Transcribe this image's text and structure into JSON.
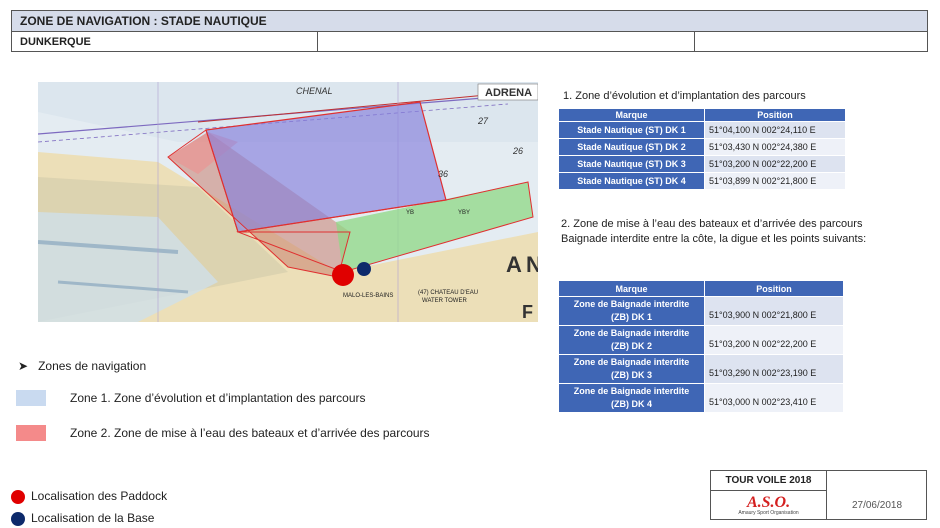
{
  "header": {
    "title": "ZONE DE NAVIGATION : STADE NAUTIQUE",
    "location": "DUNKERQUE"
  },
  "map": {
    "brand": "ADRENA",
    "labels": {
      "chenal": "CHENAL",
      "town": "MALO-LES-BAINS",
      "water_tower": "(47) CHATEAU D'EAU",
      "water_tower_en": "WATER TOWER",
      "yb": "YB",
      "yby": "YBY",
      "n26": "26",
      "n27": "27",
      "n36": "36",
      "bigA": "A",
      "bigN": "N",
      "bigF": "F"
    }
  },
  "section1": {
    "title": "1. Zone d’évolution et d’implantation des parcours",
    "headers": [
      "Marque",
      "Position"
    ],
    "rows": [
      {
        "mark": "Stade Nautique (ST) DK 1",
        "pos": "51°04,100 N  002°24,110 E"
      },
      {
        "mark": "Stade Nautique (ST) DK 2",
        "pos": "51°03,430 N  002°24,380 E"
      },
      {
        "mark": "Stade Nautique (ST) DK 3",
        "pos": "51°03,200 N  002°22,200 E"
      },
      {
        "mark": "Stade Nautique (ST) DK 4",
        "pos": "51°03,899 N  002°21,800 E"
      }
    ]
  },
  "section2": {
    "title": "2. Zone de mise à l’eau des bateaux et d’arrivée des parcours",
    "subtitle": "Baignade interdite entre la côte, la digue et les points suivants:",
    "headers": [
      "Marque",
      "Position"
    ],
    "rows": [
      {
        "mark1": "Zone de Baignade interdite",
        "mark2": "(ZB) DK 1",
        "pos": "51°03,900 N  002°21,800 E"
      },
      {
        "mark1": "Zone de Baignade interdite",
        "mark2": "(ZB) DK 2",
        "pos": "51°03,200 N  002°22,200 E"
      },
      {
        "mark1": "Zone de Baignade interdite",
        "mark2": "(ZB) DK 3",
        "pos": "51°03,290 N  002°23,190 E"
      },
      {
        "mark1": "Zone de Baignade interdite",
        "mark2": "(ZB) DK 4",
        "pos": "51°03,000 N  002°23,410 E"
      }
    ]
  },
  "legend": {
    "title": "Zones de navigation",
    "zone1": "Zone 1. Zone d’évolution et d’implantation des parcours",
    "zone2": "Zone 2. Zone de mise à l’eau des bateaux et d’arrivée des parcours",
    "paddock": "Localisation des Paddock",
    "base": "Localisation de la Base",
    "colors": {
      "zone1": "#c9daf0",
      "zone2": "#f48a8a",
      "paddock": "#e00000",
      "base": "#0d2a6b"
    }
  },
  "footer": {
    "event": "TOUR VOILE 2018",
    "logo": "A.S.O.",
    "logo_sub": "Amaury Sport Organisation",
    "date": "27/06/2018"
  }
}
